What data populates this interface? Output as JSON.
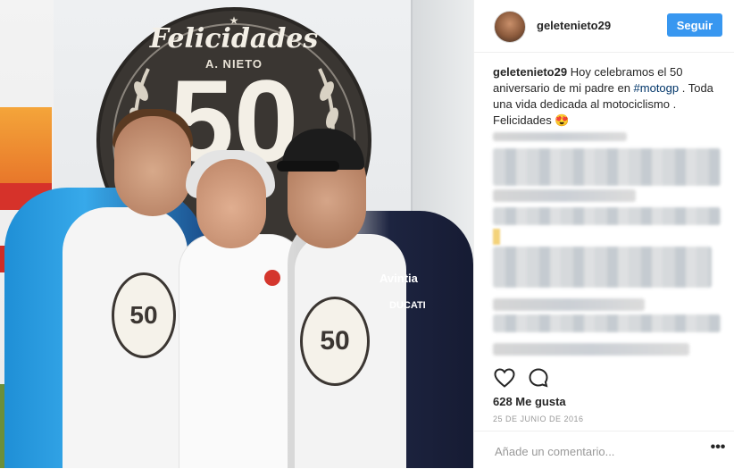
{
  "photo": {
    "emblem_title": "Felicidades",
    "emblem_subtitle": "A. NIETO",
    "emblem_number": "50",
    "tee_number": "50",
    "jacket_brand": "Avintia",
    "jacket_sponsor": "DUCATI"
  },
  "header": {
    "username": "geletenieto29",
    "follow_label": "Seguir"
  },
  "caption": {
    "username": "geletenieto29",
    "text_before_tag": " Hoy celebramos el 50 aniversario de mi padre en ",
    "hashtag": "#motogp",
    "text_after_tag": " . Toda una vida dedicada al motociclismo . Felicidades ",
    "emoji": "😍"
  },
  "actions": {
    "like_icon": "heart-outline-icon",
    "comment_icon": "speech-bubble-icon"
  },
  "likes": "628 Me gusta",
  "date": "25 DE JUNIO DE 2016",
  "comment_box": {
    "placeholder": "Añade un comentario...",
    "more_label": "•••"
  },
  "colors": {
    "follow_button": "#3897f0",
    "hashtag": "#003569",
    "text": "#262626",
    "muted": "#999999",
    "divider": "#efefef"
  }
}
